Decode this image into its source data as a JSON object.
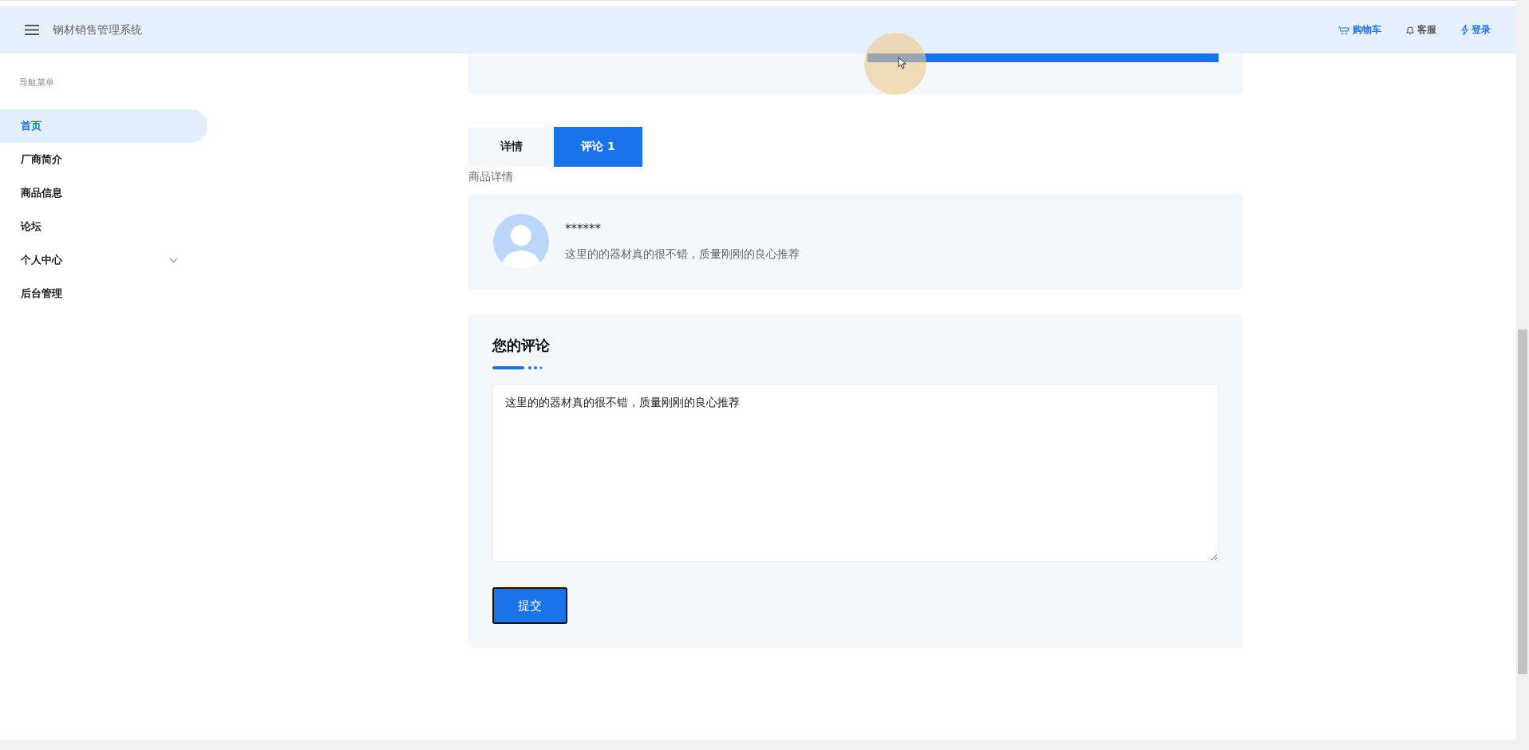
{
  "header": {
    "title": "钢材销售管理系统",
    "actions": [
      {
        "kind": "cart",
        "label": "购物车"
      },
      {
        "kind": "bell",
        "label": "客服"
      },
      {
        "kind": "bolt",
        "label": "登录"
      }
    ]
  },
  "sidebar": {
    "heading": "导航菜单",
    "items": [
      {
        "label": "首页",
        "selected": true
      },
      {
        "label": "厂商简介",
        "selected": false
      },
      {
        "label": "商品信息",
        "selected": false
      },
      {
        "label": "论坛",
        "selected": false
      },
      {
        "label": "个人中心",
        "selected": false,
        "expanded": false
      },
      {
        "label": "后台管理",
        "selected": false
      }
    ]
  },
  "tabs": [
    {
      "label": "详情",
      "selected": false
    },
    {
      "label": "评论 1",
      "selected": true
    }
  ],
  "section_label": "商品详情",
  "comments": [
    {
      "user": "******",
      "text": "这里的的器材真的很不错，质量刚刚的良心推荐"
    }
  ],
  "comment_form": {
    "title": "您的评论",
    "value": "这里的的器材真的很不错，质量刚刚的良心推荐",
    "submit": "提交"
  }
}
